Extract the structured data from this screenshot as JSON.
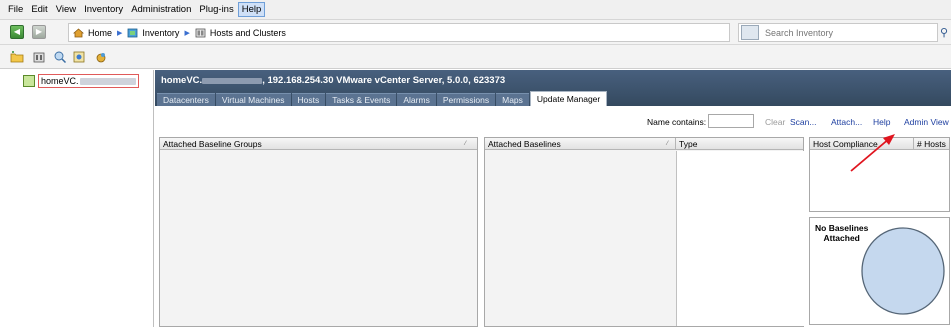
{
  "menu": [
    "File",
    "Edit",
    "View",
    "Inventory",
    "Administration",
    "Plug-ins",
    "Help"
  ],
  "breadcrumb": {
    "home": "Home",
    "inventory": "Inventory",
    "current": "Hosts and Clusters"
  },
  "search": {
    "placeholder": "Search Inventory"
  },
  "tree": {
    "root_label": "homeVC."
  },
  "header": {
    "title_prefix": "homeVC.",
    "title_suffix": ", 192.168.254.30 VMware vCenter Server, 5.0.0, 623373"
  },
  "tabs": [
    "Datacenters",
    "Virtual Machines",
    "Hosts",
    "Tasks & Events",
    "Alarms",
    "Permissions",
    "Maps",
    "Update Manager"
  ],
  "active_tab": "Update Manager",
  "actions": {
    "name_contains": "Name contains:",
    "clear": "Clear",
    "scan": "Scan...",
    "attach": "Attach...",
    "help": "Help",
    "admin_view": "Admin View"
  },
  "columns": {
    "baseline_groups": "Attached Baseline Groups",
    "baselines": "Attached Baselines",
    "type": "Type",
    "host_compliance": "Host Compliance",
    "hosts": "# Hosts"
  },
  "compliance_chart": {
    "message_line1": "No Baselines",
    "message_line2": "Attached"
  },
  "colors": {
    "header_bg": "#3f5670",
    "link": "#1e3fa0",
    "annotation_arrow": "#e0141e",
    "pie_fill": "#c5d8ee"
  },
  "icons": [
    "back-arrow-icon",
    "forward-arrow-icon",
    "home-icon",
    "inventory-icon",
    "hosts-clusters-icon",
    "search-scope-icon",
    "search-go-icon",
    "new-folder-icon",
    "new-datacenter-icon",
    "add-host-icon",
    "refresh-icon",
    "plugin-icon",
    "vcenter-icon"
  ]
}
